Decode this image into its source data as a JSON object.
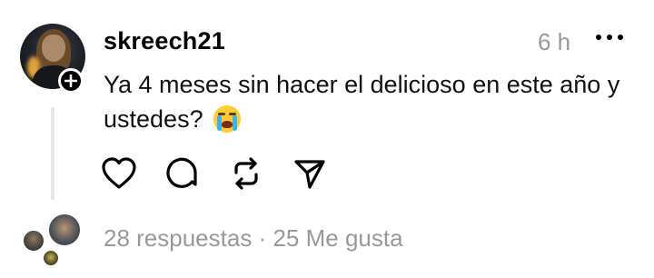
{
  "post": {
    "username": "skreech21",
    "time": "6 h",
    "text": "Ya 4 meses sin hacer el delicioso en este año y ustedes?",
    "emoji": "loudly-crying-face"
  },
  "actions": {
    "like_icon": "heart-icon",
    "reply_icon": "comment-icon",
    "repost_icon": "repost-icon",
    "share_icon": "send-icon"
  },
  "stats": {
    "replies": "28 respuestas",
    "separator": "·",
    "likes": "25 Me gusta"
  }
}
